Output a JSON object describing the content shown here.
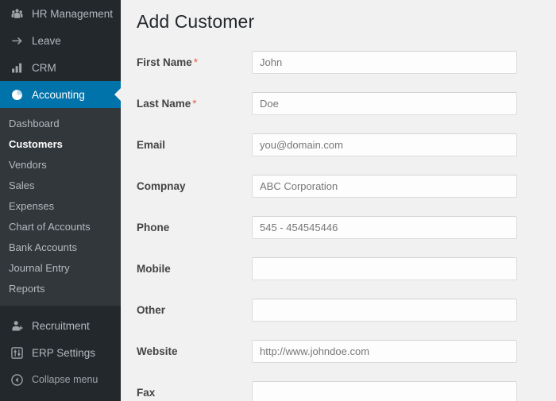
{
  "sidebar": {
    "top_items": [
      {
        "label": "HR Management",
        "icon": "group-users-icon",
        "active": false
      },
      {
        "label": "Leave",
        "icon": "arrow-right-icon",
        "active": false
      },
      {
        "label": "CRM",
        "icon": "bar-chart-icon",
        "active": false
      },
      {
        "label": "Accounting",
        "icon": "pie-chart-icon",
        "active": true
      }
    ],
    "submenu": [
      {
        "label": "Dashboard",
        "current": false
      },
      {
        "label": "Customers",
        "current": true
      },
      {
        "label": "Vendors",
        "current": false
      },
      {
        "label": "Sales",
        "current": false
      },
      {
        "label": "Expenses",
        "current": false
      },
      {
        "label": "Chart of Accounts",
        "current": false
      },
      {
        "label": "Bank Accounts",
        "current": false
      },
      {
        "label": "Journal Entry",
        "current": false
      },
      {
        "label": "Reports",
        "current": false
      }
    ],
    "bottom_items": [
      {
        "label": "Recruitment",
        "icon": "user-plus-icon"
      },
      {
        "label": "ERP Settings",
        "icon": "sliders-icon"
      }
    ],
    "collapse": {
      "label": "Collapse menu",
      "icon": "chevron-left-circle-icon"
    }
  },
  "main": {
    "title": "Add Customer",
    "required_marker": "*",
    "fields": [
      {
        "label": "First Name",
        "required": true,
        "value": "",
        "placeholder": "John"
      },
      {
        "label": "Last Name",
        "required": true,
        "value": "",
        "placeholder": "Doe"
      },
      {
        "label": "Email",
        "required": false,
        "value": "",
        "placeholder": "you@domain.com"
      },
      {
        "label": "Compnay",
        "required": false,
        "value": "",
        "placeholder": "ABC Corporation"
      },
      {
        "label": "Phone",
        "required": false,
        "value": "",
        "placeholder": "545 - 454545446"
      },
      {
        "label": "Mobile",
        "required": false,
        "value": "",
        "placeholder": ""
      },
      {
        "label": "Other",
        "required": false,
        "value": "",
        "placeholder": ""
      },
      {
        "label": "Website",
        "required": false,
        "value": "",
        "placeholder": "http://www.johndoe.com"
      },
      {
        "label": "Fax",
        "required": false,
        "value": "",
        "placeholder": ""
      }
    ]
  },
  "colors": {
    "sidebar_bg": "#23282d",
    "submenu_bg": "#32373c",
    "active_blue": "#0073aa",
    "page_bg": "#f1f1f1",
    "required_red": "#e8604c"
  }
}
